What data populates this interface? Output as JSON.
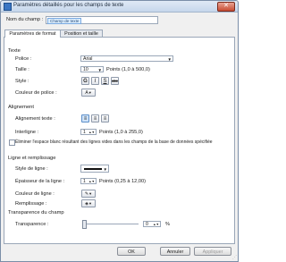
{
  "window": {
    "title": "Paramètres détaillés pour les champs de texte",
    "close_glyph": "✕"
  },
  "name_field": {
    "label": "Nom du champ :",
    "value": "Champ de texte"
  },
  "tabs": [
    {
      "label": "Paramètres de format"
    },
    {
      "label": "Position et taille"
    }
  ],
  "texte": {
    "heading": "Texte",
    "police_label": "Police :",
    "police_value": "Arial",
    "taille_label": "Taille :",
    "taille_value": "10",
    "taille_unit": "Points (1,0 à 500,0)",
    "style_label": "Style :",
    "style_buttons": [
      "G",
      "I",
      "S",
      "abc"
    ],
    "couleur_label": "Couleur de police :",
    "couleur_color": "#1b1b1b"
  },
  "alignement": {
    "heading": "Alignement",
    "texte_label": "Alignement texte :",
    "interligne_label": "Interligne :",
    "interligne_value": "1",
    "interligne_unit": "Points (1,0 à 255,0)",
    "eliminate_label": "Éliminer l'espace blanc résultant des lignes vides dans les champs de la base de données spécifiée"
  },
  "ligne": {
    "heading": "Ligne et remplissage",
    "style_label": "Style de ligne :",
    "epaisseur_label": "Épaisseur de la ligne :",
    "epaisseur_value": "1",
    "epaisseur_unit": "Points (0,25 à 12,00)",
    "couleur_label": "Couleur de ligne :",
    "remplissage_label": "Remplissage :",
    "line_color": "#111111"
  },
  "transparence": {
    "heading": "Transparence du champ",
    "label": "Transparence :",
    "value": "0",
    "unit": "%",
    "level": 0
  },
  "buttons": {
    "ok": "OK",
    "annuler": "Annuler",
    "appliquer": "Appliquer"
  },
  "colors": {
    "accent": "#3a76c4",
    "border": "#9aa7b8",
    "panel": "#ffffff",
    "window": "#f0f0f0"
  }
}
